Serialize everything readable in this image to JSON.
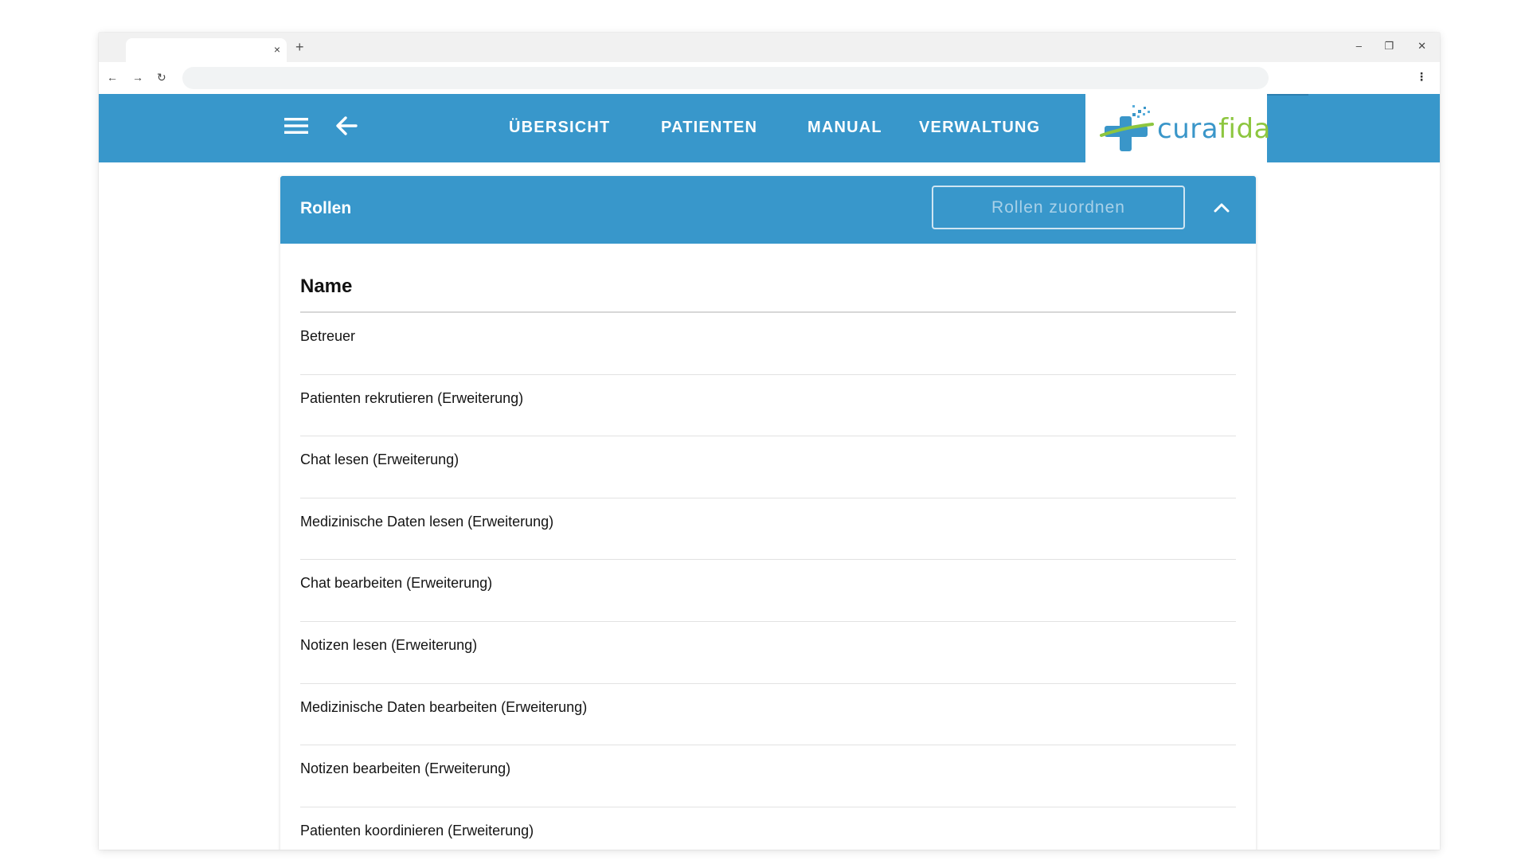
{
  "browser": {
    "tab_close_glyph": "×",
    "new_tab_glyph": "+",
    "minimize_glyph": "–",
    "restore_glyph": "❐",
    "close_glyph": "✕",
    "back_glyph": "←",
    "forward_glyph": "→",
    "reload_glyph": "↻",
    "menu_glyph": "⋮"
  },
  "header": {
    "nav": [
      "ÜBERSICHT",
      "PATIENTEN",
      "MANUAL",
      "VERWALTUNG"
    ],
    "logo": {
      "main": "cura",
      "accent": "fida"
    },
    "colors": {
      "primary": "#3897cb",
      "logo_blue": "#3a96c9",
      "logo_green": "#8dc63f"
    }
  },
  "panel": {
    "title": "Rollen",
    "assign_button": "Rollen zuordnen",
    "column_header": "Name",
    "rows": [
      "Betreuer",
      "Patienten rekrutieren (Erweiterung)",
      "Chat lesen (Erweiterung)",
      "Medizinische Daten lesen (Erweiterung)",
      "Chat bearbeiten (Erweiterung)",
      "Notizen lesen (Erweiterung)",
      "Medizinische Daten bearbeiten (Erweiterung)",
      "Notizen bearbeiten (Erweiterung)",
      "Patienten koordinieren (Erweiterung)"
    ]
  }
}
